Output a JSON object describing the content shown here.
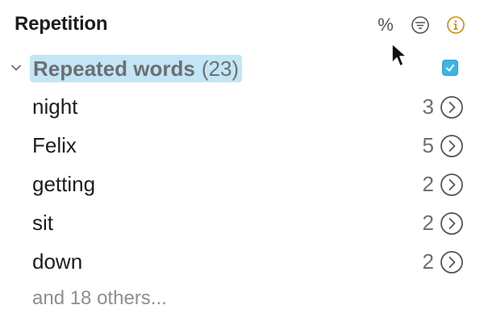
{
  "header": {
    "title": "Repetition",
    "percent_label": "%",
    "icons": [
      "percent-icon",
      "filter-icon",
      "info-icon"
    ],
    "info_color": "#d48a0a"
  },
  "group": {
    "label": "Repeated words",
    "count": "(23)",
    "checked": true,
    "highlight_color": "#c3e6f5",
    "checkbox_color": "#3fb4e5"
  },
  "words": [
    {
      "word": "night",
      "count": "3"
    },
    {
      "word": "Felix",
      "count": "5"
    },
    {
      "word": "getting",
      "count": "2"
    },
    {
      "word": "sit",
      "count": "2"
    },
    {
      "word": "down",
      "count": "2"
    }
  ],
  "footer": {
    "others_label": "and 18 others..."
  }
}
